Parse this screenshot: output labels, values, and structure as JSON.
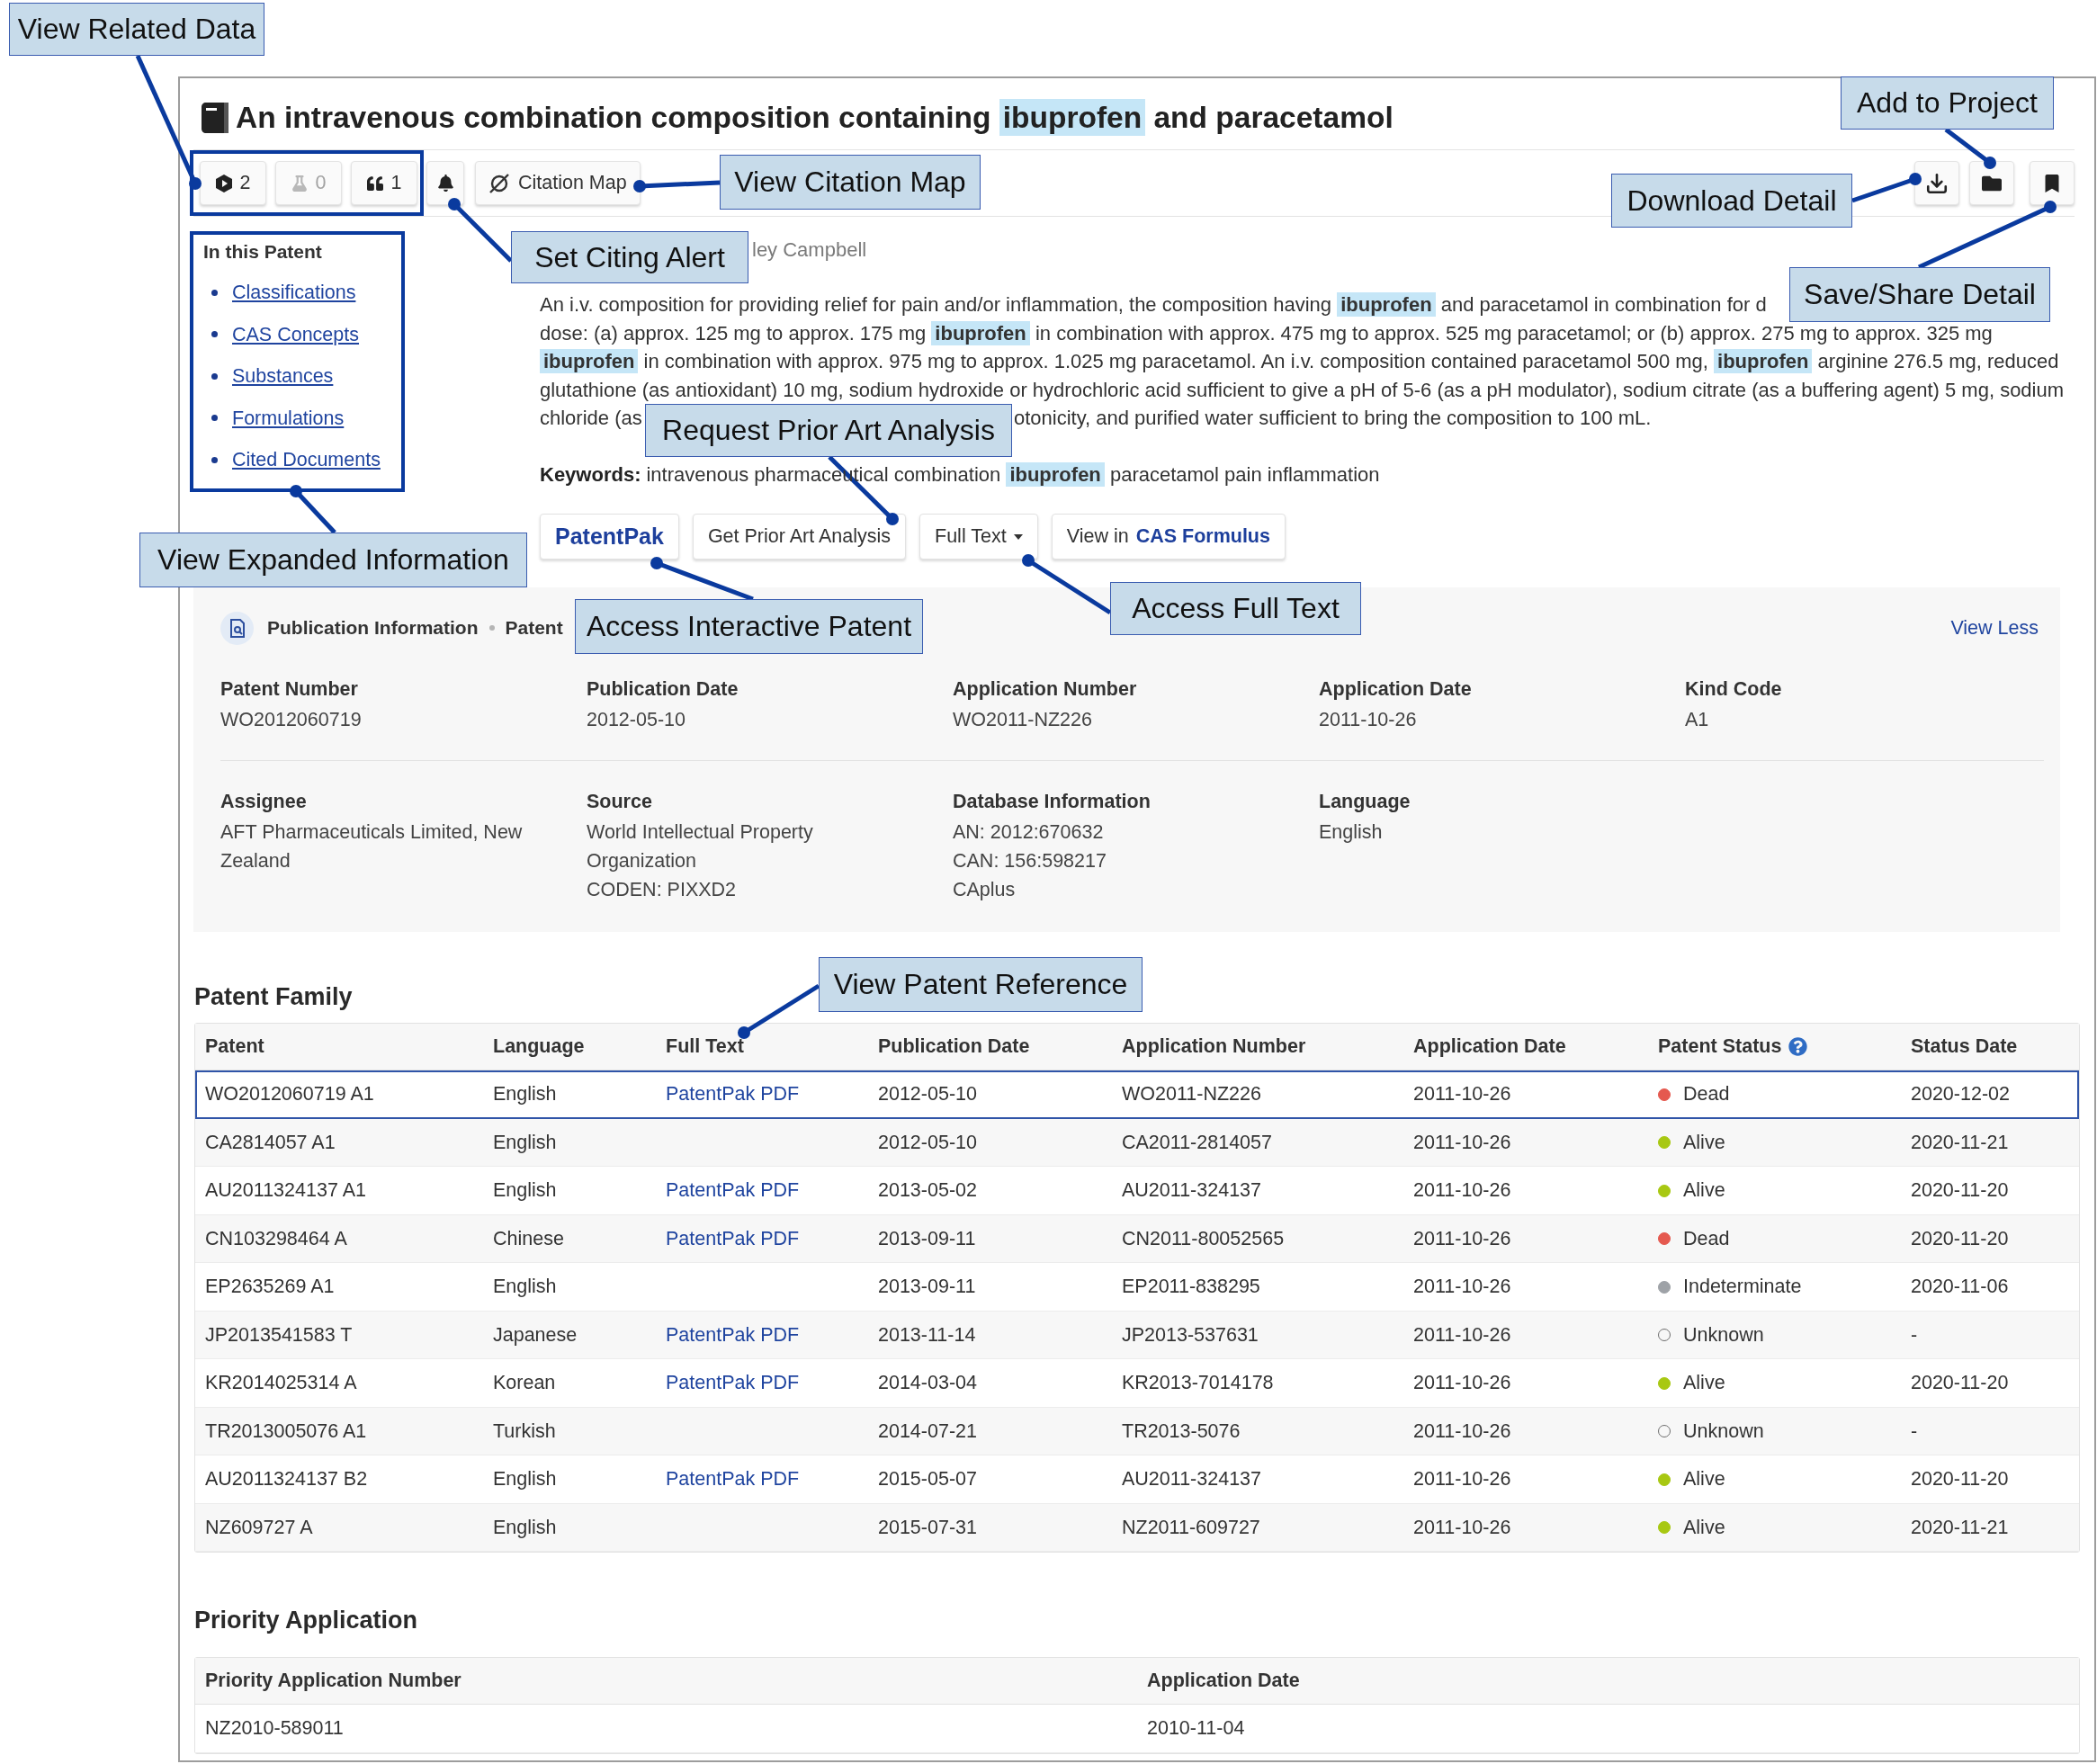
{
  "title": "An intravenous combination composition containing **ibuprofen** and paracetamol",
  "related_counts": [
    {
      "kind": "hexagon",
      "count": "2",
      "disabled": false
    },
    {
      "kind": "flask",
      "count": "0",
      "disabled": true
    },
    {
      "kind": "quote",
      "count": "1",
      "disabled": false
    }
  ],
  "citation_map": {
    "label": "Citation Map"
  },
  "in_this_patent": {
    "heading": "In this Patent",
    "links": [
      "Classifications",
      "CAS Concepts",
      "Substances",
      "Formulations",
      "Cited Documents"
    ]
  },
  "inventors": "ley Campbell",
  "abstract_lines": [
    {
      "segments": [
        "An i.v. composition for providing relief for pain and/or inflammation, the composition having **ibuprofen** and paracetamol in combination for d"
      ]
    },
    {
      "segments": [
        "dose: (a) approx. 125 mg to approx. 175 mg **ibuprofen** in combination with approx. 475 mg to approx. 525 mg paracetamol; or (b) approx. 275 mg to approx. 325 mg"
      ]
    },
    {
      "segments": [
        "**ibuprofen** in combination with approx. 975 mg to approx. 1.025 mg paracetamol. An i.v. composition contained paracetamol 500 mg, **ibuprofen** arginine 276.5 mg, reduced"
      ]
    },
    {
      "segments": [
        "glutathione (as antioxidant) 10 mg, sodium hydroxide or hydrochloric acid sufficient to give a pH of 5-6 (as a pH modulator), sodium citrate (as a buffering agent) 5 mg, sodium"
      ]
    },
    {
      "segments": [
        "chloride (as",
        "otonicity, and purified water sufficient to bring the composition to 100 mL."
      ]
    }
  ],
  "keywords": {
    "label": "Keywords:",
    "text": "intravenous pharmaceutical combination **ibuprofen** paracetamol pain inflammation"
  },
  "actions": [
    {
      "kind": "brand",
      "label": "PatentPak"
    },
    {
      "kind": "plain",
      "label": "Get Prior Art Analysis"
    },
    {
      "kind": "dropdown",
      "label": "Full Text"
    },
    {
      "kind": "plain",
      "label": "View in **CAS Formulus**"
    }
  ],
  "publication_info": {
    "sections": [
      "Publication Information",
      "Patent"
    ],
    "view_less": "View Less",
    "rows": [
      [
        {
          "label": "Patent Number",
          "lines": [
            "WO2012060719"
          ]
        },
        {
          "label": "Publication Date",
          "lines": [
            "2012-05-10"
          ]
        },
        {
          "label": "Application Number",
          "lines": [
            "WO2011-NZ226"
          ]
        },
        {
          "label": "Application Date",
          "lines": [
            "2011-10-26"
          ]
        },
        {
          "label": "Kind Code",
          "lines": [
            "A1"
          ]
        }
      ],
      [
        {
          "label": "Assignee",
          "lines": [
            "AFT Pharmaceuticals Limited, New Zealand"
          ]
        },
        {
          "label": "Source",
          "lines": [
            "World Intellectual Property Organization",
            "CODEN: PIXXD2"
          ]
        },
        {
          "label": "Database Information",
          "lines": [
            "AN: 2012:670632",
            "CAN: 156:598217",
            "CAplus"
          ]
        },
        {
          "label": "Language",
          "lines": [
            "English"
          ]
        }
      ]
    ]
  },
  "patent_family": {
    "heading": "Patent Family",
    "columns": [
      {
        "label": "Patent",
        "help": false
      },
      {
        "label": "Language",
        "help": false
      },
      {
        "label": "Full Text",
        "help": false
      },
      {
        "label": "Publication Date",
        "help": false
      },
      {
        "label": "Application Number",
        "help": false
      },
      {
        "label": "Application Date",
        "help": false
      },
      {
        "label": "Patent Status",
        "help": true
      },
      {
        "label": "Status Date",
        "help": false
      }
    ],
    "rows": [
      {
        "selected": true,
        "patent": "WO2012060719 A1",
        "language": "English",
        "full_text": "PatentPak PDF",
        "publication_date": "2012-05-10",
        "application_number": "WO2011-NZ226",
        "application_date": "2011-10-26",
        "status": {
          "label": "Dead",
          "color": "#e5594f",
          "filled": true
        },
        "status_date": "2020-12-02"
      },
      {
        "selected": false,
        "patent": "CA2814057 A1",
        "language": "English",
        "publication_date": "2012-05-10",
        "application_number": "CA2011-2814057",
        "application_date": "2011-10-26",
        "status": {
          "label": "Alive",
          "color": "#a8c812",
          "filled": true
        },
        "status_date": "2020-11-21"
      },
      {
        "selected": false,
        "patent": "AU2011324137 A1",
        "language": "English",
        "full_text": "PatentPak PDF",
        "publication_date": "2013-05-02",
        "application_number": "AU2011-324137",
        "application_date": "2011-10-26",
        "status": {
          "label": "Alive",
          "color": "#a8c812",
          "filled": true
        },
        "status_date": "2020-11-20"
      },
      {
        "selected": false,
        "patent": "CN103298464 A",
        "language": "Chinese",
        "full_text": "PatentPak PDF",
        "publication_date": "2013-09-11",
        "application_number": "CN2011-80052565",
        "application_date": "2011-10-26",
        "status": {
          "label": "Dead",
          "color": "#e5594f",
          "filled": true
        },
        "status_date": "2020-11-20"
      },
      {
        "selected": false,
        "patent": "EP2635269 A1",
        "language": "English",
        "publication_date": "2013-09-11",
        "application_number": "EP2011-838295",
        "application_date": "2011-10-26",
        "status": {
          "label": "Indeterminate",
          "color": "#9ea2a7",
          "filled": true
        },
        "status_date": "2020-11-06"
      },
      {
        "selected": false,
        "patent": "JP2013541583 T",
        "language": "Japanese",
        "full_text": "PatentPak PDF",
        "publication_date": "2013-11-14",
        "application_number": "JP2013-537631",
        "application_date": "2011-10-26",
        "status": {
          "label": "Unknown",
          "color": "#6e6e6e",
          "filled": false
        },
        "status_date": "-"
      },
      {
        "selected": false,
        "patent": "KR2014025314 A",
        "language": "Korean",
        "full_text": "PatentPak PDF",
        "publication_date": "2014-03-04",
        "application_number": "KR2013-7014178",
        "application_date": "2011-10-26",
        "status": {
          "label": "Alive",
          "color": "#a8c812",
          "filled": true
        },
        "status_date": "2020-11-20"
      },
      {
        "selected": false,
        "patent": "TR2013005076 A1",
        "language": "Turkish",
        "publication_date": "2014-07-21",
        "application_number": "TR2013-5076",
        "application_date": "2011-10-26",
        "status": {
          "label": "Unknown",
          "color": "#6e6e6e",
          "filled": false
        },
        "status_date": "-"
      },
      {
        "selected": false,
        "patent": "AU2011324137 B2",
        "language": "English",
        "full_text": "PatentPak PDF",
        "publication_date": "2015-05-07",
        "application_number": "AU2011-324137",
        "application_date": "2011-10-26",
        "status": {
          "label": "Alive",
          "color": "#a8c812",
          "filled": true
        },
        "status_date": "2020-11-20"
      },
      {
        "selected": false,
        "patent": "NZ609727 A",
        "language": "English",
        "publication_date": "2015-07-31",
        "application_number": "NZ2011-609727",
        "application_date": "2011-10-26",
        "status": {
          "label": "Alive",
          "color": "#a8c812",
          "filled": true
        },
        "status_date": "2020-11-21"
      }
    ]
  },
  "priority_application": {
    "heading": "Priority Application",
    "columns": [
      "Priority Application Number",
      "Application Date"
    ],
    "rows": [
      [
        "NZ2010-589011",
        "2010-11-04"
      ]
    ]
  },
  "callouts": [
    "View Related Data",
    "Add to Project",
    "View Citation Map",
    "Download Detail",
    "Set Citing Alert",
    "Save/Share Detail",
    "Request Prior Art Analysis",
    "View Expanded Information",
    "Access Full Text",
    "Access Interactive Patent",
    "View Patent Reference"
  ]
}
